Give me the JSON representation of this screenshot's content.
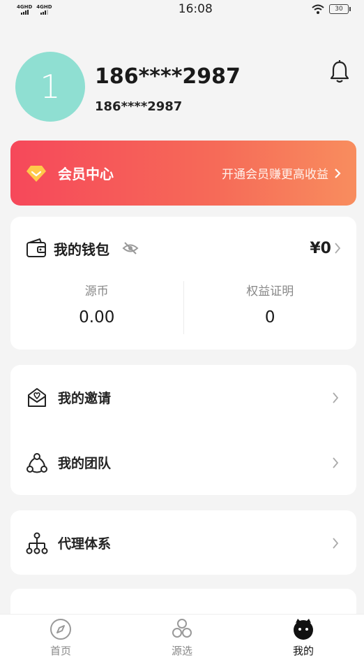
{
  "status_bar": {
    "signal_1": "4GHD",
    "signal_2": "4GHD",
    "time": "16:08",
    "battery": "30"
  },
  "profile": {
    "avatar_initial": "1",
    "name": "186****2987",
    "phone": "186****2987"
  },
  "vip": {
    "title": "会员中心",
    "cta": "开通会员赚更高收益"
  },
  "wallet": {
    "title": "我的钱包",
    "amount": "¥0",
    "columns": [
      {
        "label": "源币",
        "value": "0.00"
      },
      {
        "label": "权益证明",
        "value": "0"
      }
    ]
  },
  "menu": {
    "invite": "我的邀请",
    "team": "我的团队",
    "agent": "代理体系"
  },
  "tabs": [
    {
      "label": "首页",
      "icon": "compass-icon"
    },
    {
      "label": "源选",
      "icon": "hexagon-cluster-icon"
    },
    {
      "label": "我的",
      "icon": "profile-face-icon"
    }
  ],
  "colors": {
    "background": "#f4f4f4",
    "vip_gradient_start": "#f6485a",
    "vip_gradient_end": "#f88d5e",
    "avatar": "#8fdfd2",
    "diamond": "#ffc94a"
  }
}
